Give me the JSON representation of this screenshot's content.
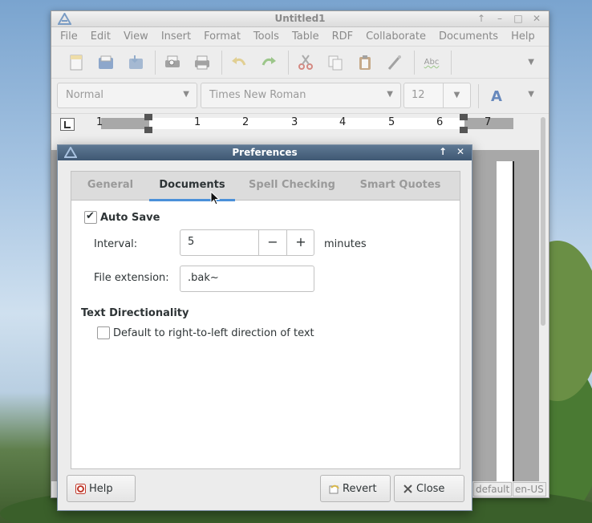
{
  "window": {
    "title": "Untitled1",
    "controls": [
      "↑",
      "–",
      "□",
      "✕"
    ]
  },
  "menu": [
    "File",
    "Edit",
    "View",
    "Insert",
    "Format",
    "Tools",
    "Table",
    "RDF",
    "Collaborate",
    "Documents",
    "Help"
  ],
  "toolbar": {
    "icons": [
      "new-document-icon",
      "open-icon",
      "save-icon",
      "print-preview-icon",
      "print-icon",
      "undo-icon",
      "redo-icon",
      "cut-icon",
      "copy-icon",
      "paste-icon",
      "format-painter-icon",
      "spellcheck-icon"
    ],
    "spellcheck_text": "Abc"
  },
  "format_bar": {
    "style": "Normal",
    "font": "Times New Roman",
    "size": "12",
    "font_color_glyph": "A"
  },
  "ruler": {
    "numbers": [
      "1",
      "1",
      "2",
      "3",
      "4",
      "5",
      "6",
      "7"
    ]
  },
  "status": {
    "page_style": "default",
    "language": "en-US"
  },
  "dialog": {
    "title": "Preferences",
    "controls": [
      "↑",
      "✕"
    ],
    "tabs": [
      "General",
      "Documents",
      "Spell Checking",
      "Smart Quotes"
    ],
    "active_tab": "Documents",
    "auto_save_label": "Auto Save",
    "auto_save_checked": true,
    "interval_label": "Interval:",
    "interval_value": "5",
    "interval_unit": "minutes",
    "minus": "−",
    "plus": "+",
    "extension_label": "File extension:",
    "extension_value": ".bak~",
    "section_directionality": "Text Directionality",
    "rtl_label": "Default to right-to-left direction of text",
    "rtl_checked": false,
    "help_button": "Help",
    "revert_button": "Revert",
    "close_button": "Close"
  },
  "colors": {
    "dialog_title_bg": "#4f6882",
    "active_tab_underline": "#4a90d9",
    "disabled_text": "#9a9a9a"
  }
}
